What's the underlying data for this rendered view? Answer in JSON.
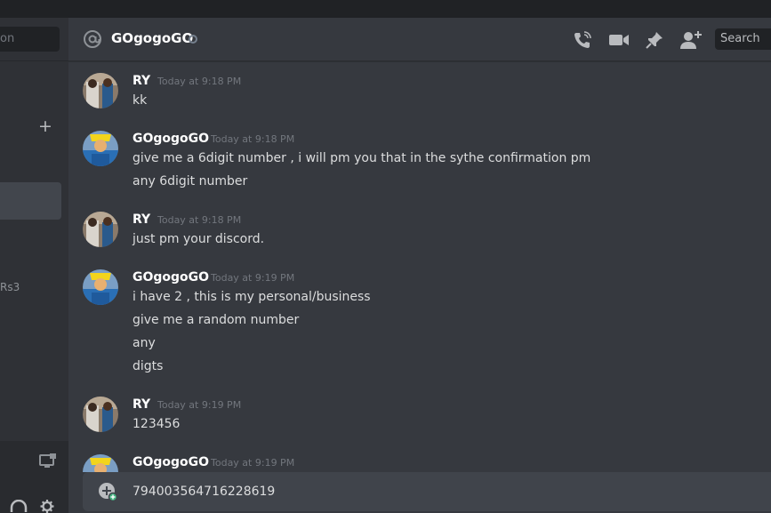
{
  "sidebar": {
    "search_fragment": "on",
    "add_icon": "plus-icon",
    "dm_fragment": "Rs3"
  },
  "header": {
    "channel_name": "GOgogoGO",
    "search_placeholder": "Search",
    "icons": [
      "phone-call-icon",
      "video-call-icon",
      "pin-icon",
      "add-friend-icon"
    ]
  },
  "messages": [
    {
      "author": "RY",
      "timestamp": "Today at 9:18 PM",
      "avatar": "ry",
      "lines": [
        "kk"
      ]
    },
    {
      "author": "GOgogoGO",
      "timestamp": "Today at 9:18 PM",
      "avatar": "go",
      "lines": [
        "give me a 6digit number , i will pm you that in the sythe confirmation pm",
        "any 6digit number"
      ]
    },
    {
      "author": "RY",
      "timestamp": "Today at 9:18 PM",
      "avatar": "ry",
      "lines": [
        "just pm your discord."
      ]
    },
    {
      "author": "GOgogoGO",
      "timestamp": "Today at 9:19 PM",
      "avatar": "go",
      "lines": [
        "i have 2 , this is my personal/business",
        "give me a random number",
        "any",
        "digts"
      ]
    },
    {
      "author": "RY",
      "timestamp": "Today at 9:19 PM",
      "avatar": "ry",
      "lines": [
        "123456"
      ]
    },
    {
      "author": "GOgogoGO",
      "timestamp": "Today at 9:19 PM",
      "avatar": "go",
      "lines": []
    }
  ],
  "composer": {
    "value": "794003564716228619"
  },
  "colors": {
    "background": "#36393f",
    "sidebar": "#2f3136",
    "input": "#40444b",
    "accent_green": "#43b581"
  }
}
